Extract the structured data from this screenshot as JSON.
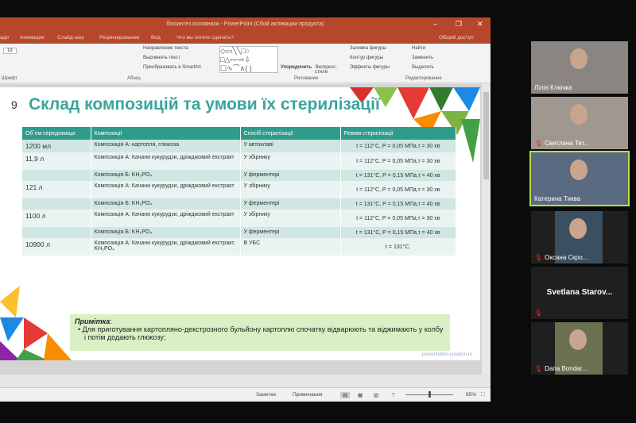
{
  "window": {
    "title": "біосинтез ксиланази - PowerPoint (Сбой активации продукта)",
    "minimize": "–",
    "restore": "❐",
    "close": "✕"
  },
  "tabs": [
    "ади",
    "Анимация",
    "Слайд-шоу",
    "Рецензирование",
    "Вид"
  ],
  "tell_me": "Что вы хотите сделать?",
  "share": "Общий доступ",
  "ribbon": {
    "font_size": "18",
    "text_direction": "Направление текста",
    "align_text": "Выровнять текст",
    "smartart": "Преобразовать в SmartArt",
    "arrange": "Упорядочить",
    "quick_styles": "Экспресс-стили",
    "fill": "Заливка фигуры",
    "outline": "Контур фигуры",
    "effects": "Эффекты фигуры",
    "find": "Найти",
    "replace": "Заменить",
    "select": "Выделить",
    "groups": {
      "font": "Шрифт",
      "paragraph": "Абзац",
      "drawing": "Рисование",
      "editing": "Редактирование"
    }
  },
  "slide": {
    "number": "9",
    "title": "Склад композицій та умови їх стерилізації",
    "headers": [
      "Об`єм середовища",
      "Композиції",
      "Спосіб стерилізації",
      "Режим стерилізації"
    ],
    "rows": [
      {
        "vol": "1200 мл",
        "comp": "Композиція А: картопля, глюкоза",
        "method": "У автоклаві",
        "mode": "t = 112°C, P = 0,05 МПа,τ = 30 хв",
        "style": "a"
      },
      {
        "vol": "11,9 л",
        "comp": "Композиція А: Качани кукурудзи, дріжджовий екстракт",
        "method": "У збірнику",
        "mode": "t = 112°C, P = 0,05 МПа,τ = 30 хв",
        "style": "b"
      },
      {
        "vol": "",
        "comp": "Композиція Б: KH₂PO₄",
        "method": "У ферментері",
        "mode": "t = 131°C, P = 0,15 МПа,τ = 40 хв",
        "style": "a"
      },
      {
        "vol": "121 л",
        "comp": "Композиція А: Качани кукурудзи, дріжджовий екстракт",
        "method": "У збірнику",
        "mode": "t = 112°C, P = 0,05 МПа,τ = 30 хв",
        "style": "b"
      },
      {
        "vol": "",
        "comp": "Композиція Б: KH₂PO₄",
        "method": "У ферментері",
        "mode": "t = 131°C, P = 0,15 МПа,τ = 40 хв",
        "style": "a"
      },
      {
        "vol": "1100 л",
        "comp": "Композиція А: Качани кукурудзи, дріжджовий екстракт",
        "method": "У збірнику",
        "mode": "t = 112°C, P = 0,05 МПа,τ = 30 хв",
        "style": "b"
      },
      {
        "vol": "",
        "comp": "Композиція Б: KH₂PO₄",
        "method": "У ферментері",
        "mode": "t = 131°C, P = 0,15 МПа,τ = 40 хв",
        "style": "a"
      },
      {
        "vol": "10900 л",
        "comp": "Композиція А: Качани кукурудзи, дріжджовий екстракт, KH₂PO₄",
        "method": "В УБС",
        "mode": "t = 131°C,",
        "style": "b"
      }
    ],
    "note_title": "Примітка",
    "note_text": "Для приготування картопляно-декстрозного бульйону картоплю спочатку відварюють та віджимають у колбу і потім додають глюкозу;",
    "watermark": "presentation-creation.ru"
  },
  "status": {
    "notes": "Заметки",
    "comments": "Примечания",
    "zoom": "85%",
    "zoom_level": 85
  },
  "participants": [
    {
      "name": "Лілія Ключка",
      "muted": false,
      "active": false,
      "color": "#8a8580"
    },
    {
      "name": "Светлана Тет...",
      "muted": true,
      "active": false,
      "color": "#a09890"
    },
    {
      "name": "Катерина Тиква",
      "muted": false,
      "active": true,
      "color": "#5a6a80"
    },
    {
      "name": "Оксана Скро...",
      "muted": true,
      "active": false,
      "color": "#3a5060"
    },
    {
      "name": "Svetlana  Starov...",
      "muted": true,
      "active": false,
      "color": ""
    },
    {
      "name": "Daria Bondar...",
      "muted": true,
      "active": false,
      "color": "#6a7050"
    }
  ]
}
